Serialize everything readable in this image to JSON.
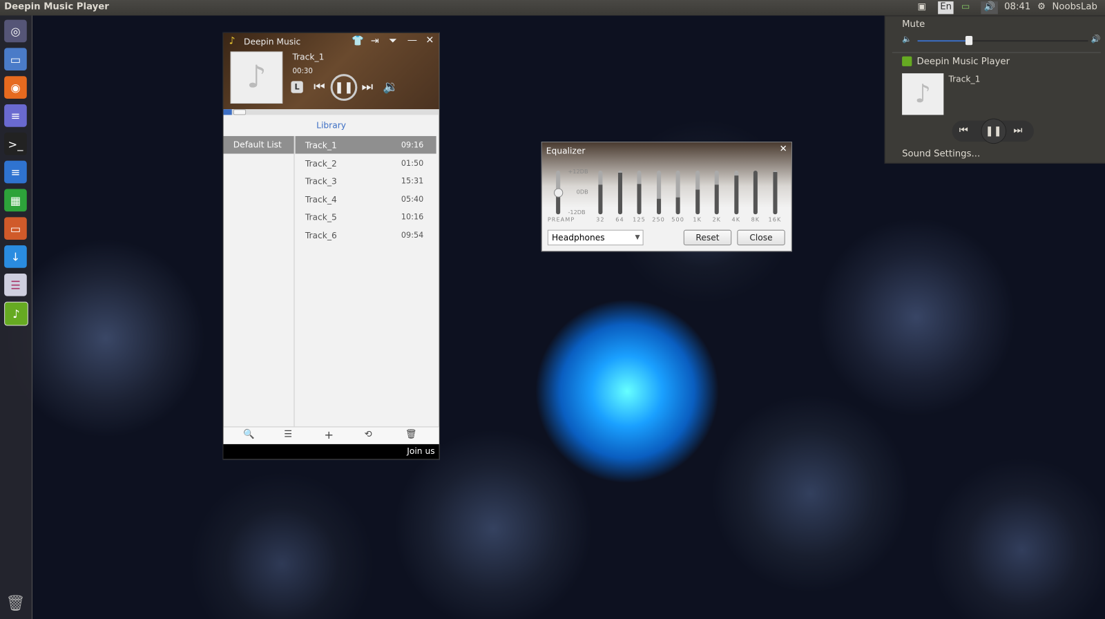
{
  "topbar": {
    "title": "Deepin Music Player",
    "lang": "En",
    "time": "08:41",
    "user": "NoobsLab"
  },
  "player": {
    "title": "Deepin Music",
    "track": "Track_1",
    "elapsed": "00:30",
    "mode_label": "L",
    "library_label": "Library",
    "join_label": "Join us",
    "lists": [
      {
        "label": "Default List"
      }
    ],
    "tracks": [
      {
        "name": "Track_1",
        "duration": "09:16"
      },
      {
        "name": "Track_2",
        "duration": "01:50"
      },
      {
        "name": "Track_3",
        "duration": "15:31"
      },
      {
        "name": "Track_4",
        "duration": "05:40"
      },
      {
        "name": "Track_5",
        "duration": "10:16"
      },
      {
        "name": "Track_6",
        "duration": "09:54"
      }
    ]
  },
  "equalizer": {
    "title": "Equalizer",
    "scale": [
      "+12DB",
      "0DB",
      "-12DB"
    ],
    "preamp": {
      "label": "PREAMP",
      "level": 0.5
    },
    "bands": [
      {
        "label": "32",
        "level": 0.68
      },
      {
        "label": "64",
        "level": 0.95
      },
      {
        "label": "125",
        "level": 0.7
      },
      {
        "label": "250",
        "level": 0.35
      },
      {
        "label": "500",
        "level": 0.38
      },
      {
        "label": "1K",
        "level": 0.56
      },
      {
        "label": "2K",
        "level": 0.68
      },
      {
        "label": "4K",
        "level": 0.88
      },
      {
        "label": "8K",
        "level": 1.0
      },
      {
        "label": "16K",
        "level": 0.97
      }
    ],
    "preset": "Headphones",
    "reset_label": "Reset",
    "close_label": "Close"
  },
  "sound_menu": {
    "mute_label": "Mute",
    "volume": 0.3,
    "app_name": "Deepin Music Player",
    "track": "Track_1",
    "settings_label": "Sound Settings..."
  },
  "colors": {
    "accent": "#3d6fc4",
    "selected_row": "#8f8f8f"
  }
}
